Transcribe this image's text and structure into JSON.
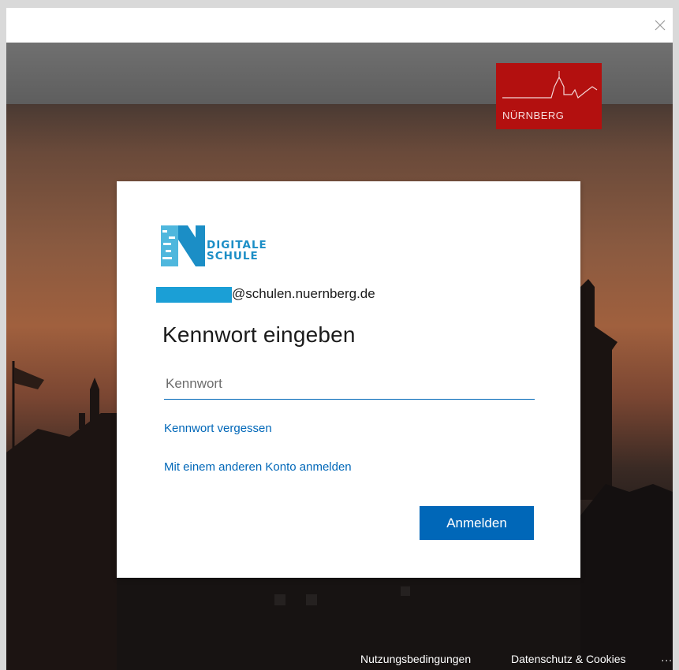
{
  "window": {
    "close_icon": "close-icon"
  },
  "brand": {
    "city_name": "NÜRNBERG",
    "color": "#b3100f"
  },
  "card": {
    "logo": {
      "line1": "DIGITALE",
      "line2": "SCHULE",
      "color": "#1b8ec6"
    },
    "email_suffix": "@schulen.nuernberg.de",
    "heading": "Kennwort eingeben",
    "password_placeholder": "Kennwort",
    "password_value": "",
    "forgot_link": "Kennwort vergessen",
    "other_account_link": "Mit einem anderen Konto anmelden",
    "submit_label": "Anmelden",
    "accent_color": "#0067b8"
  },
  "footer": {
    "terms": "Nutzungsbedingungen",
    "privacy": "Datenschutz & Cookies",
    "more": "..."
  }
}
